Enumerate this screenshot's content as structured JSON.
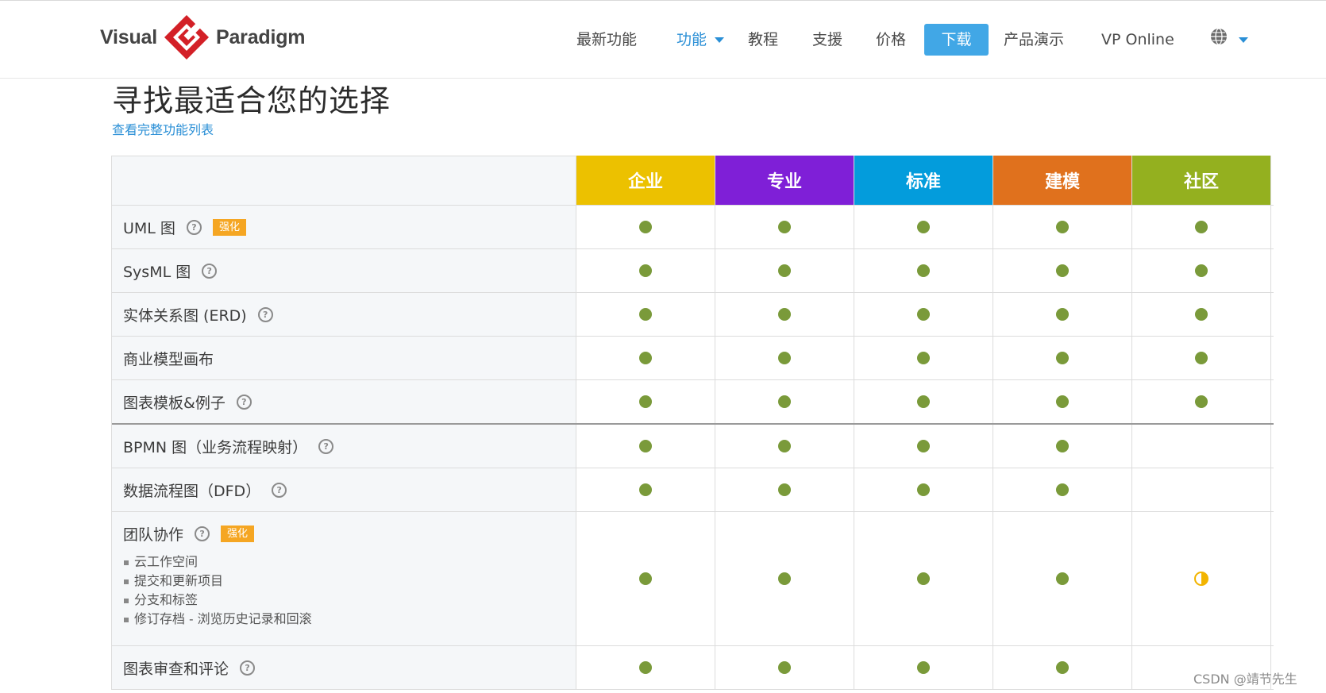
{
  "header": {
    "logo": {
      "left": "Visual",
      "right": "Paradigm"
    },
    "nav": [
      {
        "label": "最新功能"
      },
      {
        "label": "功能"
      },
      {
        "label": "教程"
      },
      {
        "label": "支援"
      },
      {
        "label": "价格"
      },
      {
        "label": "下载"
      },
      {
        "label": "产品演示"
      },
      {
        "label": "VP Online"
      }
    ],
    "colors": {
      "active": "#2a8fd6",
      "download_bg": "#41a7e6"
    },
    "language_icon": "globe-icon"
  },
  "title": "寻找最适合您的选择",
  "full_list_link": "查看完整功能列表",
  "editions": [
    {
      "name": "企业",
      "color": "#ecc100"
    },
    {
      "name": "专业",
      "color": "#7f1fd7"
    },
    {
      "name": "标准",
      "color": "#039cdc"
    },
    {
      "name": "建模",
      "color": "#e0711d"
    },
    {
      "name": "社区",
      "color": "#94b01f"
    }
  ],
  "features": [
    {
      "name": "UML 图",
      "help": true,
      "badge": "强化",
      "support": [
        "full",
        "full",
        "full",
        "full",
        "full"
      ]
    },
    {
      "name": "SysML 图",
      "help": true,
      "badge": "",
      "support": [
        "full",
        "full",
        "full",
        "full",
        "full"
      ]
    },
    {
      "name": "实体关系图 (ERD)",
      "help": true,
      "badge": "",
      "support": [
        "full",
        "full",
        "full",
        "full",
        "full"
      ]
    },
    {
      "name": "商业模型画布",
      "help": false,
      "badge": "",
      "support": [
        "full",
        "full",
        "full",
        "full",
        "full"
      ]
    },
    {
      "name": "图表模板&例子",
      "help": true,
      "badge": "",
      "support": [
        "full",
        "full",
        "full",
        "full",
        "full"
      ]
    },
    {
      "name": "BPMN 图（业务流程映射）",
      "help": true,
      "badge": "",
      "support": [
        "full",
        "full",
        "full",
        "full",
        "none"
      ]
    },
    {
      "name": "数据流程图（DFD）",
      "help": true,
      "badge": "",
      "support": [
        "full",
        "full",
        "full",
        "full",
        "none"
      ]
    },
    {
      "name": "团队协作",
      "help": true,
      "badge": "强化",
      "sub": [
        "云工作空间",
        "提交和更新项目",
        "分支和标签",
        "修订存档 - 浏览历史记录和回滚"
      ],
      "support": [
        "full",
        "full",
        "full",
        "full",
        "partial"
      ]
    },
    {
      "name": "图表审查和评论",
      "help": true,
      "badge": "",
      "support": [
        "full",
        "full",
        "full",
        "full",
        "none"
      ]
    }
  ],
  "watermark": "CSDN @靖节先生"
}
